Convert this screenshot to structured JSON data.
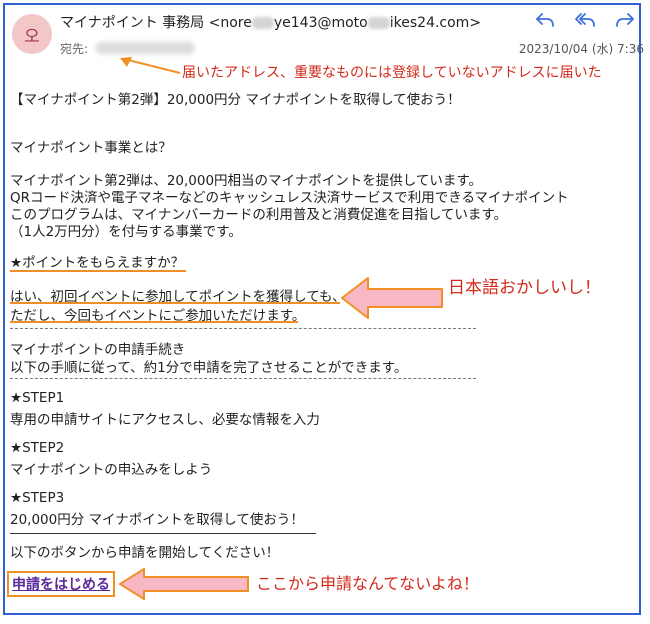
{
  "header": {
    "avatar_initial": "오",
    "sender_name": "マイナポイント 事務局",
    "sender_email_a": "<nore",
    "sender_email_b": "ye143@moto",
    "sender_email_c": "ikes24.com>",
    "to_label": "宛先:",
    "date": "2023/10/04 (水) 7:36"
  },
  "annotations": {
    "address_note": "届いたアドレス、重要なものには登録していないアドレスに届いた",
    "japanese_note": "日本語おかしいし！",
    "apply_note": "ここから申請なんてないよね！"
  },
  "body": {
    "subject_line": "【マイナポイント第2弾】20,000円分 マイナポイントを取得して使おう！",
    "about_heading": "マイナポイント事業とは？",
    "about_1": "マイナポイント第2弾は、20,000円相当のマイナポイントを提供しています。",
    "about_2": "QRコード決済や電子マネーなどのキャッシュレス決済サービスで利用できるマイナポイント",
    "about_3": "このプログラムは、マイナンバーカードの利用普及と消費促進を目指しています。",
    "about_4": "（1人2万円分）を付与する事業です。",
    "q_heading": "★ポイントをもらえますか？",
    "q_answer_1": "はい、初回イベントに参加してポイントを獲得しても、",
    "q_answer_2": "ただし、今回もイベントにご参加いただけます。",
    "proc_heading": "マイナポイントの申請手続き",
    "proc_desc": "以下の手順に従って、約1分で申請を完了させることができます。",
    "step1_title": "★STEP1",
    "step1_desc": "専用の申請サイトにアクセスし、必要な情報を入力",
    "step2_title": "★STEP2",
    "step2_desc": "マイナポイントの申込みをしよう",
    "step3_title": "★STEP3",
    "step3_desc": "20,000円分 マイナポイントを取得して使おう！",
    "start_text": "以下のボタンから申請を開始してください！",
    "apply_label": "申請をはじめる"
  },
  "colors": {
    "frame": "#2f5fd0",
    "annotation_text": "#d32a1a",
    "highlight": "#ef8f25",
    "arrow_fill": "#f7b8c4",
    "link": "#5b2a9a",
    "action_icon": "#3d6fe0"
  },
  "icons": [
    "reply-icon",
    "reply-all-icon",
    "forward-icon"
  ]
}
